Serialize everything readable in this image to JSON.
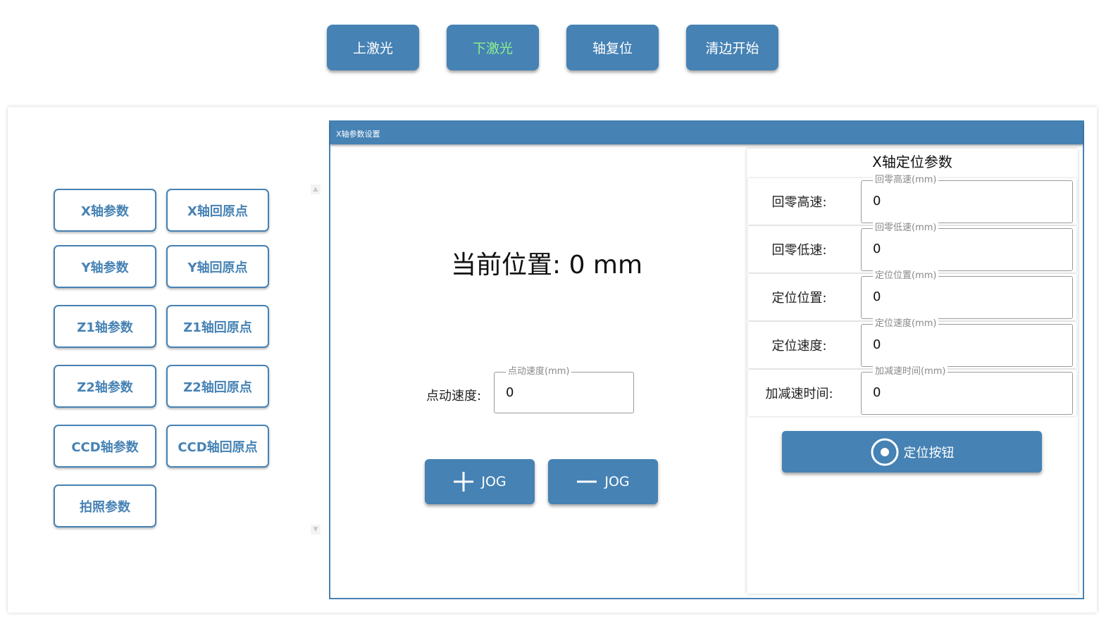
{
  "toolbar": {
    "buttons": [
      {
        "label": "上激光"
      },
      {
        "label": "下激光",
        "color": "#8cf08c"
      },
      {
        "label": "轴复位"
      },
      {
        "label": "清边开始"
      }
    ]
  },
  "sidebar": {
    "buttons": [
      {
        "label": "X轴参数"
      },
      {
        "label": "X轴回原点"
      },
      {
        "label": "Y轴参数"
      },
      {
        "label": "Y轴回原点"
      },
      {
        "label": "Z1轴参数"
      },
      {
        "label": "Z1轴回原点"
      },
      {
        "label": "Z2轴参数"
      },
      {
        "label": "Z2轴回原点"
      },
      {
        "label": "CCD轴参数"
      },
      {
        "label": "CCD轴回原点"
      },
      {
        "label": "拍照参数"
      }
    ],
    "scroll_up_icon": "arrow-up",
    "scroll_down_icon": "arrow-down"
  },
  "window": {
    "title": "X轴参数设置",
    "current_position": "当前位置: 0 mm",
    "jog_speed": {
      "label": "点动速度:",
      "legend": "点动速度(mm)",
      "value": "0"
    },
    "jog_plus": {
      "icon": "plus-icon",
      "label": "JOG"
    },
    "jog_minus": {
      "icon": "minus-icon",
      "label": "JOG"
    }
  },
  "positioning": {
    "title": "X轴定位参数",
    "params": [
      {
        "label": "回零高速:",
        "legend": "回零高速(mm)",
        "value": "0"
      },
      {
        "label": "回零低速:",
        "legend": "回零低速(mm)",
        "value": "0"
      },
      {
        "label": "定位位置:",
        "legend": "定位位置(mm)",
        "value": "0"
      },
      {
        "label": "定位速度:",
        "legend": "定位速度(mm)",
        "value": "0"
      },
      {
        "label": "加减速时间:",
        "legend": "加减速时间(mm)",
        "value": "0"
      }
    ],
    "locate_button": {
      "icon": "target-icon",
      "label": "定位按钮"
    }
  },
  "colors": {
    "accent": "#4682b4",
    "active_text": "#8cf08c"
  }
}
